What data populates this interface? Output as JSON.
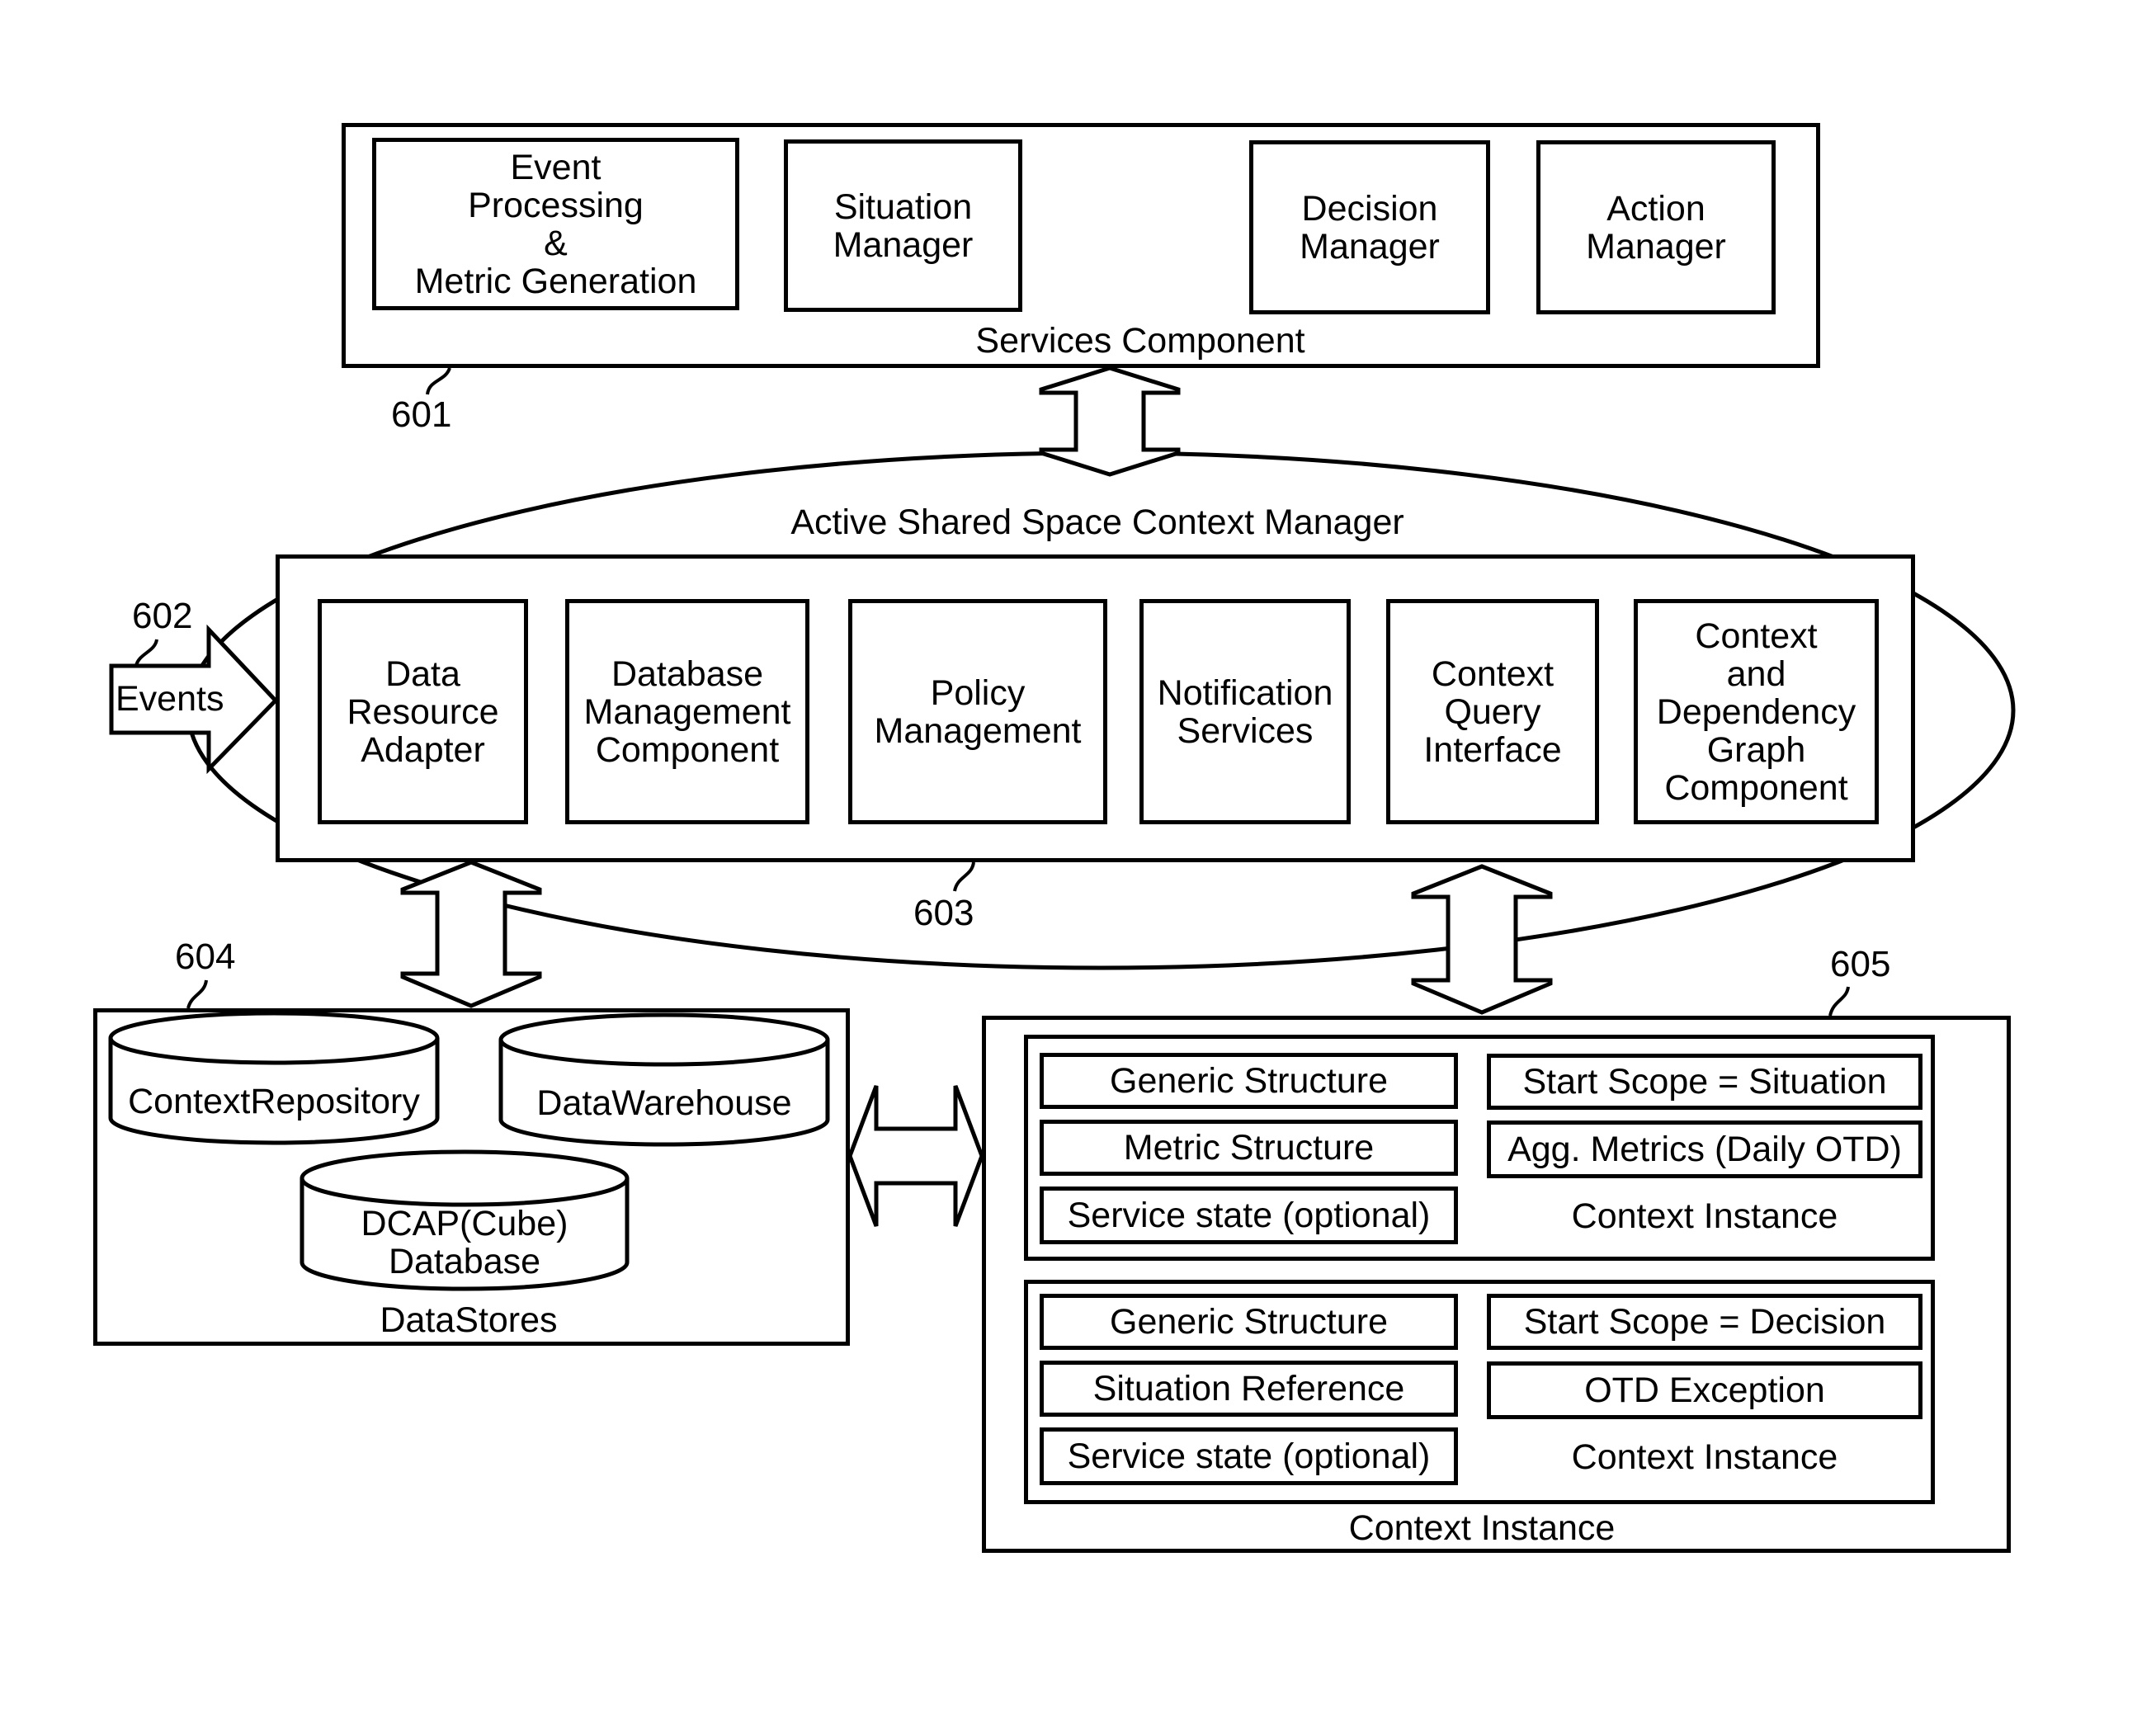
{
  "services_component": {
    "ref": "601",
    "label": "Services Component",
    "modules": [
      {
        "label": "Event\nProcessing\n&\nMetric Generation"
      },
      {
        "label": "Situation\nManager"
      },
      {
        "label": "Decision\nManager"
      },
      {
        "label": "Action\nManager"
      }
    ]
  },
  "context_manager": {
    "ellipse_label": "Active Shared Space Context Manager",
    "ref": "603",
    "events_ref": "602",
    "events_label": "Events",
    "modules": [
      {
        "label": "Data\nResource\nAdapter"
      },
      {
        "label": "Database\nManagement\nComponent"
      },
      {
        "label": "Policy\nManagement"
      },
      {
        "label": "Notification\nServices"
      },
      {
        "label": "Context\nQuery\nInterface"
      },
      {
        "label": "Context\nand\nDependency\nGraph\nComponent"
      }
    ]
  },
  "datastores": {
    "ref": "604",
    "label": "DataStores",
    "stores": [
      {
        "label": "ContextRepository"
      },
      {
        "label": "DataWarehouse"
      },
      {
        "label": "DCAP(Cube)\nDatabase"
      }
    ]
  },
  "context_instance": {
    "ref": "605",
    "label": "Context Instance",
    "instances": [
      {
        "left": [
          "Generic Structure",
          "Metric Structure",
          "Service state (optional)"
        ],
        "right": [
          "Start Scope = Situation",
          "Agg. Metrics (Daily OTD)"
        ],
        "caption": "Context Instance"
      },
      {
        "left": [
          "Generic Structure",
          "Situation Reference",
          "Service state (optional)"
        ],
        "right": [
          "Start Scope = Decision",
          "OTD Exception"
        ],
        "caption": "Context Instance"
      }
    ]
  }
}
